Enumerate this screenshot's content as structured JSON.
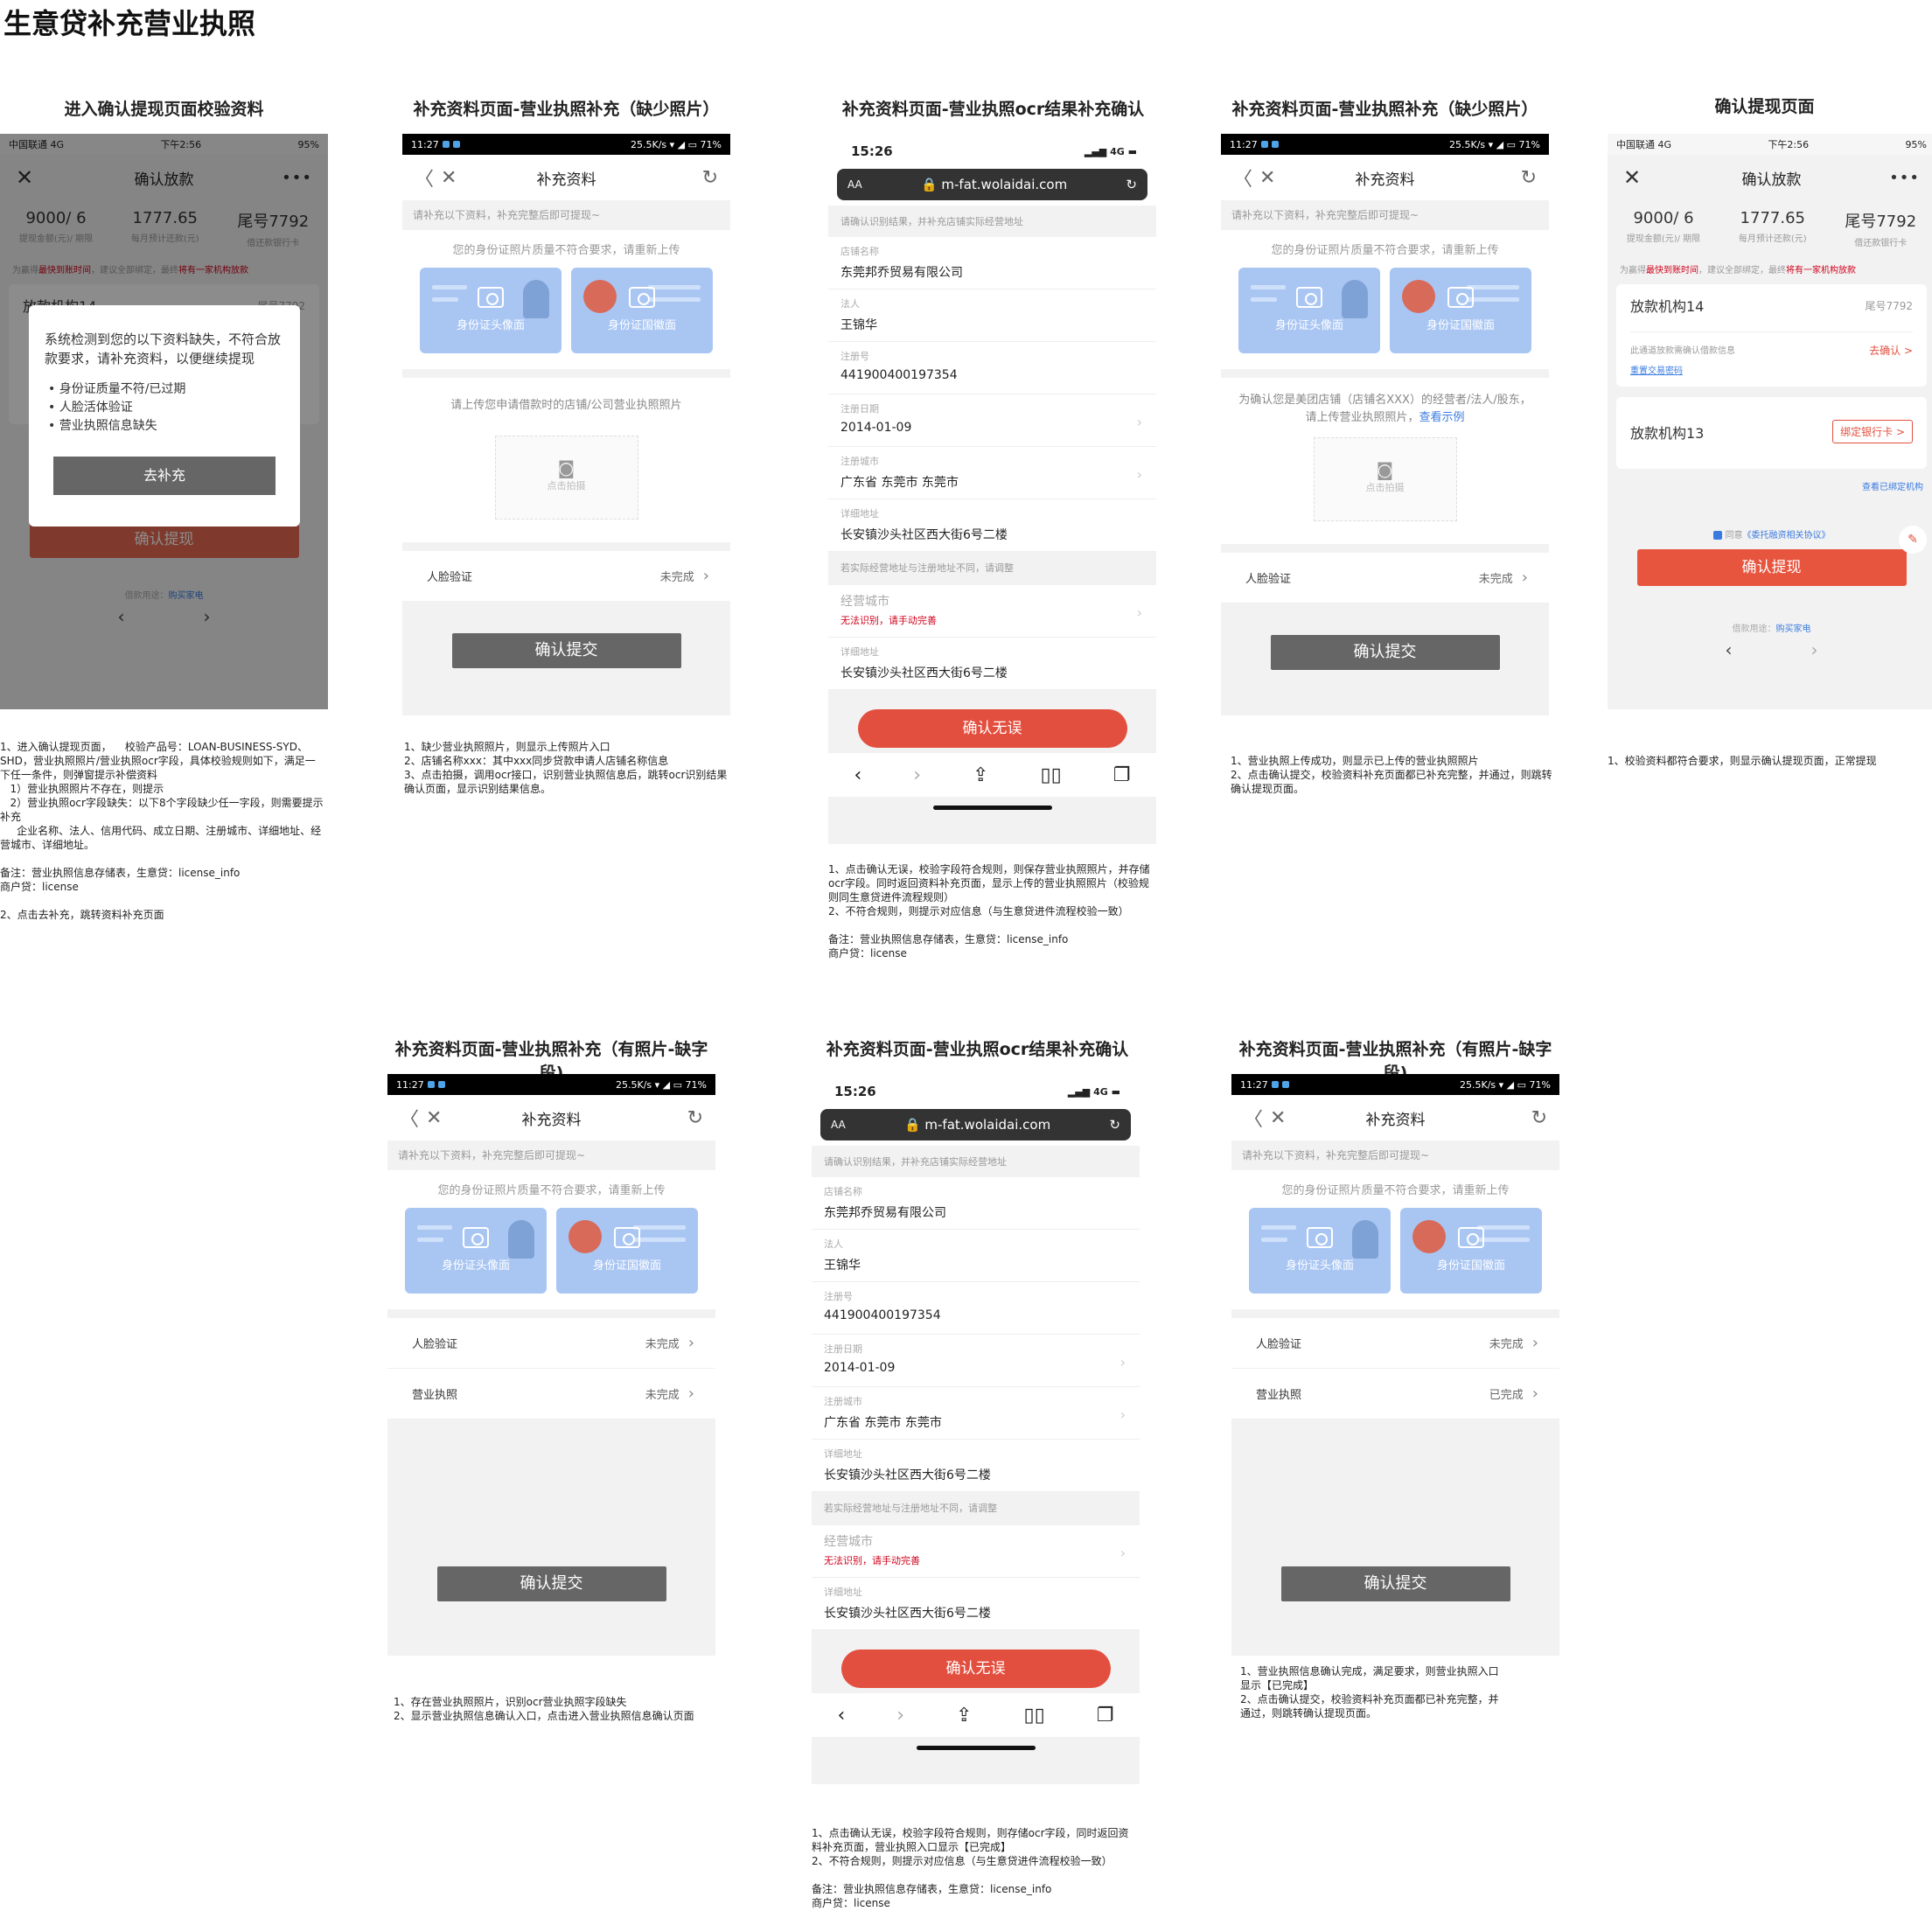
{
  "page_title": "生意贷补充营业执照",
  "frames": {
    "f1": {
      "title": "进入确认提现页面校验资料"
    },
    "f2": {
      "title": "补充资料页面-营业执照补充（缺少照片）"
    },
    "f3": {
      "title": "补充资料页面-营业执照ocr结果补充确认"
    },
    "f4": {
      "title": "补充资料页面-营业执照补充（缺少照片）"
    },
    "f5": {
      "title": "确认提现页面"
    },
    "f6": {
      "title": "补充资料页面-营业执照补充（有照片-缺字段)"
    },
    "f7": {
      "title": "补充资料页面-营业执照ocr结果补充确认"
    },
    "f8": {
      "title": "补充资料页面-营业执照补充（有照片-缺字段)"
    }
  },
  "android_status": {
    "time": "11:27",
    "speed": "25.5K/s",
    "battery": "71%"
  },
  "carrier_status": {
    "carrier": "中国联通 4G",
    "time": "下午2:56",
    "battery": "95%"
  },
  "ios_status": {
    "time": "15:26",
    "signal": "4G",
    "url": "m-fat.wolaidai.com",
    "aa": "AA"
  },
  "supplement": {
    "nav_title": "补充资料",
    "tip": "请补充以下资料，补充完整后即可提现~",
    "id_msg": "您的身份证照片质量不符合要求，请重新上传",
    "id_front": "身份证头像面",
    "id_back": "身份证国徽面",
    "upload_msg": "请上传您申请借款时的店铺/公司营业执照照片",
    "upload_msg2": "为确认您是美团店铺（店铺名XXX）的经营者/法人/股东，请上传营业执照照片，",
    "example_link": "查看示例",
    "tap_photo": "点击拍摄",
    "face_label": "人脸验证",
    "face_status": "未完成",
    "license_label": "营业执照",
    "license_status_todo": "未完成",
    "license_status_done": "已完成",
    "submit": "确认提交"
  },
  "ocr": {
    "hint": "请确认识别结果，并补充店铺实际经营地址",
    "shop_k": "店铺名称",
    "shop_v": "东莞邦乔贸易有限公司",
    "legal_k": "法人",
    "legal_v": "王锦华",
    "reg_k": "注册号",
    "reg_v": "441900400197354",
    "date_k": "注册日期",
    "date_v": "2014-01-09",
    "city_k": "注册城市",
    "city_v": "广东省 东莞市 东莞市",
    "addr_k": "详细地址",
    "addr_v": "长安镇沙头社区西大街6号二楼",
    "diff_hint": "若实际经营地址与注册地址不同，请调整",
    "biz_city_k": "经营城市",
    "biz_city_err": "无法识别，请手动完善",
    "biz_addr_k": "详细地址",
    "biz_addr_v": "长安镇沙头社区西大街6号二楼",
    "ok": "确认无误"
  },
  "loan": {
    "nav_title": "确认放款",
    "amt1": "9000/ 6",
    "amt1_s": "提现金额(元)/ 期限",
    "amt2": "1777.65",
    "amt2_s": "每月预计还款(元)",
    "amt3": "尾号7792",
    "amt3_s": "借还款银行卡",
    "warn_pre": "为赢得",
    "warn_red": "最快到账时间",
    "warn_mid": "，建议全部绑定，最终",
    "warn_red2": "将有一家机构放款",
    "org1": "放款机构14",
    "org1_tail": "尾号7792",
    "org1_sub": "此通道放款需确认借款信息",
    "org1_act": "去确认 >",
    "org1_link": "重置交易密码",
    "org2": "放款机构13",
    "org2_btn": "绑定银行卡 >",
    "view_bound": "查看已绑定机构",
    "agree_pre": "同意",
    "agree_link": "《委托融资相关协议》",
    "confirm": "确认提现",
    "purpose_pre": "借款用途：",
    "purpose_link": "购买家电"
  },
  "modal": {
    "text": "系统检测到您的以下资料缺失，不符合放款要求，请补充资料，以便继续提现",
    "items": [
      "身份证质量不符/已过期",
      "人脸活体验证",
      "营业执照信息缺失"
    ],
    "btn": "去补充"
  },
  "notes": {
    "n1": "1、进入确认提现页面，    校验产品号：LOAN-BUSINESS-SYD、SHD，营业执照照片/营业执照ocr字段，具体校验规则如下，满足一下任一条件，则弹窗提示补偿资料\n   1）营业执照照片不存在，则提示\n   2）营业执照ocr字段缺失：以下8个字段缺少任一字段，则需要提示补充\n     企业名称、法人、信用代码、成立日期、注册城市、详细地址、经营城市、详细地址。\n\n备注：营业执照信息存储表，生意贷：license_info\n商户贷：license\n\n2、点击去补充，跳转资料补充页面",
    "n2": "1、缺少营业执照照片，则显示上传照片入口\n2、店铺名称xxx：其中xxx同步贷款申请人店铺名称信息\n3、点击拍摄，调用ocr接口，识别营业执照信息后，跳转ocr识别结果确认页面，显示识别结果信息。",
    "n3": "1、点击确认无误，校验字段符合规则，则保存营业执照照片，并存储ocr字段。同时返回资料补充页面，显示上传的营业执照照片（校验规则同生意贷进件流程规则）\n2、不符合规则，则提示对应信息（与生意贷进件流程校验一致）\n\n备注：营业执照信息存储表，生意贷：license_info\n商户贷：license",
    "n4": "1、营业执照上传成功，则显示已上传的营业执照照片\n2、点击确认提交，校验资料补充页面都已补充完整，并通过，则跳转确认提现页面。",
    "n5": "1、校验资料都符合要求，则显示确认提现页面，正常提现",
    "n6": "1、存在营业执照照片，识别ocr营业执照字段缺失\n2、显示营业执照信息确认入口，点击进入营业执照信息确认页面",
    "n7": "1、点击确认无误，校验字段符合规则，则存储ocr字段，同时返回资料补充页面，营业执照入口显示【已完成】\n2、不符合规则，则提示对应信息（与生意贷进件流程校验一致）\n\n备注：营业执照信息存储表，生意贷：license_info\n商户贷：license",
    "n8": "1、营业执照信息确认完成，满足要求，则营业执照入口显示【已完成】\n2、点击确认提交，校验资料补充页面都已补充完整，并通过，则跳转确认提现页面。"
  }
}
